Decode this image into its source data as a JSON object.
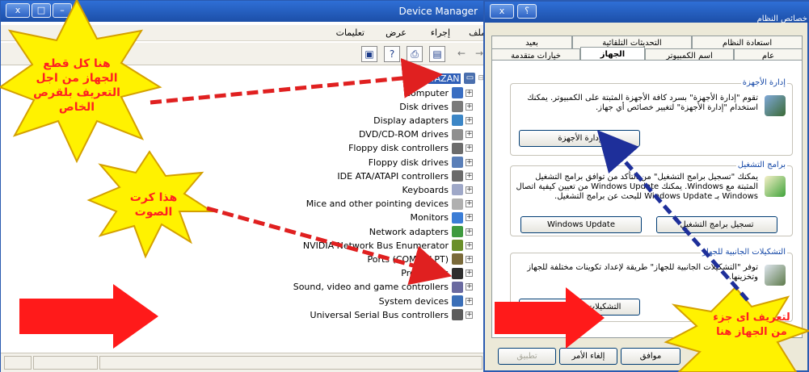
{
  "device_manager": {
    "title": "Device Manager",
    "title_buttons": [
      "x",
      "□",
      "–"
    ],
    "menu": [
      "ملف",
      "إجراء",
      "عرض",
      "تعليمات"
    ],
    "toolbar_icons": [
      "properties-icon",
      "help-icon",
      "print-icon",
      "view-icon",
      "back-arrow-icon",
      "forward-arrow-icon"
    ],
    "root": "YAZAN",
    "tree": [
      {
        "label": "Computer",
        "icon": "computer-icon"
      },
      {
        "label": "Disk drives",
        "icon": "disk-drive-icon"
      },
      {
        "label": "Display adapters",
        "icon": "display-adapter-icon"
      },
      {
        "label": "DVD/CD-ROM drives",
        "icon": "cdrom-icon"
      },
      {
        "label": "Floppy disk controllers",
        "icon": "floppy-controller-icon"
      },
      {
        "label": "Floppy disk drives",
        "icon": "floppy-drive-icon"
      },
      {
        "label": "IDE ATA/ATAPI controllers",
        "icon": "ide-controller-icon"
      },
      {
        "label": "Keyboards",
        "icon": "keyboard-icon"
      },
      {
        "label": "Mice and other pointing devices",
        "icon": "mouse-icon"
      },
      {
        "label": "Monitors",
        "icon": "monitor-icon"
      },
      {
        "label": "Network adapters",
        "icon": "network-adapter-icon"
      },
      {
        "label": "NVIDIA Network Bus Enumerator",
        "icon": "nvidia-bus-icon"
      },
      {
        "label": "Ports (COM & LPT)",
        "icon": "port-icon"
      },
      {
        "label": "Processors",
        "icon": "processor-icon"
      },
      {
        "label": "Sound, video and game controllers",
        "icon": "sound-icon"
      },
      {
        "label": "System devices",
        "icon": "system-device-icon"
      },
      {
        "label": "Universal Serial Bus controllers",
        "icon": "usb-icon"
      }
    ],
    "expander": "+"
  },
  "system_properties": {
    "title": "خصائص النظام",
    "title_buttons": [
      "x",
      "؟"
    ],
    "tabs_row1": [
      "استعادة النظام",
      "التحديثات التلقائية",
      "بعيد"
    ],
    "tabs_row2": [
      "عام",
      "اسم الكمبيوتر",
      "الجهاز",
      "خيارات متقدمة"
    ],
    "active_tab": "الجهاز",
    "device_manager_group": {
      "label": "إدارة الأجهزة",
      "text": "تقوم \"إدارة الأجهزة\" بسرد كافة الأجهزة المثبتة على الكمبيوتر. يمكنك استخدام \"إدارة الأجهزة\" لتغيير خصائص أي جهاز.",
      "button": "إدارة الأجهزة"
    },
    "drivers_group": {
      "label": "برامج التشغيل",
      "text": "يمكنك \"تسجيل برامج التشغيل\" من التأكد من توافق برامج التشغيل المثبتة مع Windows. يمكنك Windows Update من تعيين كيفية اتصال Windows بـ Windows Update للبحث عن برامج التشغيل.",
      "button_signing": "تسجيل برامج التشغيل",
      "button_update": "Windows Update"
    },
    "profiles_group": {
      "label": "التشكيلات الجانبية للجهاز",
      "text": "توفر \"التشكيلات الجانبية للجهاز\" طريقة لإعداد تكوينات مختلفة للجهاز وتخزينها.",
      "button": "التشكيلات الجانبية للجهاز"
    },
    "ok_button": "موافق",
    "cancel_button": "إلغاء الأمر",
    "apply_button": "تطبيق"
  },
  "annotations": {
    "callout_left": "هنا كل قطع الجهاز من اجل التعريف بلقرص الخاص",
    "callout_sound": "هذا كرت الصوت",
    "callout_right": "لتعريف اى جزء من الجهاز هنا",
    "arrow_color": "#ff1a1a",
    "callout_fill": "#fff200",
    "dashed_red": "#e02020",
    "dashed_blue": "#1e2f9a"
  }
}
